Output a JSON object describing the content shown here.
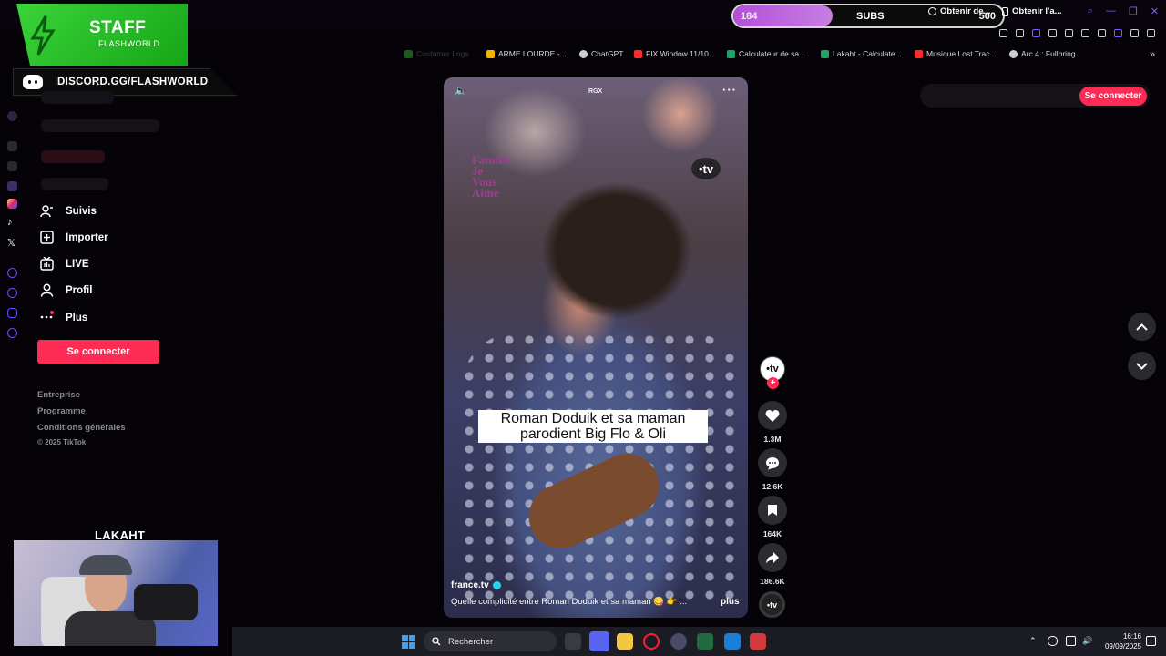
{
  "subs": {
    "current": "184",
    "label": "SUBS",
    "goal": "500",
    "progress": 0.368
  },
  "staff": {
    "title": "STAFF",
    "subtitle": "FLASHWORLD",
    "discord": "DISCORD.GG/FLASHWORLD"
  },
  "bookmarks": [
    {
      "label": "Customer Logs",
      "color": "#3aa83a",
      "dim": true
    },
    {
      "label": "ARME LOURDE -...",
      "color": "#f4b400",
      "dim": false
    },
    {
      "label": "ChatGPT",
      "color": "#cfcfcf",
      "dim": false
    },
    {
      "label": "FIX Window 11/10...",
      "color": "#ff2a2a",
      "dim": false
    },
    {
      "label": "Calculateur de sa...",
      "color": "#21a366",
      "dim": false
    },
    {
      "label": "Lakaht - Calculate...",
      "color": "#21a366",
      "dim": false
    },
    {
      "label": "Musique Lost Trac...",
      "color": "#ff2a2a",
      "dim": false
    },
    {
      "label": "Arc 4 : Fullbring",
      "color": "#cfcfcf",
      "dim": false
    }
  ],
  "sidebar": {
    "items": [
      {
        "label": "Suivis",
        "icon": "following-icon"
      },
      {
        "label": "Importer",
        "icon": "upload-icon"
      },
      {
        "label": "LIVE",
        "icon": "live-icon"
      },
      {
        "label": "Profil",
        "icon": "profile-icon"
      },
      {
        "label": "Plus",
        "icon": "more-icon"
      }
    ],
    "login_button": "Se connecter",
    "footer": [
      "Entreprise",
      "Programme",
      "Conditions générales"
    ],
    "copyright": "© 2025 TikTok"
  },
  "webcam": {
    "title": "LAKAHT"
  },
  "video": {
    "caption": "Roman Doduik et sa maman parodient Big Flo & Oli",
    "watermark": "RGX",
    "channel_logo": "Famille Je Vous Aime",
    "tv_bug": "•tv",
    "author": "france.tv",
    "description": "Quelle complicité entre Roman Doduik et sa maman 😋 👉 ...",
    "more_label": "plus"
  },
  "actions": {
    "avatar": "•tv",
    "likes": "1.3M",
    "comments": "12.6K",
    "saves": "164K",
    "shares": "186.6K"
  },
  "top_actions": {
    "coins": "Obtenir de...",
    "app": "Obtenir l'a...",
    "login": "Se connecter"
  },
  "taskbar": {
    "search_placeholder": "Rechercher",
    "time": "16:16",
    "date": "09/09/2025"
  },
  "colors": {
    "accent": "#fe2c55",
    "staff_green": "#2dbf2d",
    "subs_purple": "#c06be0"
  }
}
